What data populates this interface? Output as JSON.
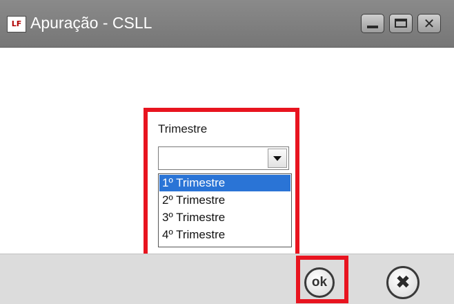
{
  "window": {
    "icon_text": "LF",
    "title": "Apuração - CSLL",
    "controls": {
      "minimize_icon": "minimize-icon",
      "maximize_icon": "maximize-icon",
      "close_icon": "close-icon",
      "close_glyph": "✕"
    }
  },
  "form": {
    "trimestre_label": "Trimestre",
    "trimestre_value": "",
    "options": [
      {
        "label": "1º Trimestre",
        "selected": true
      },
      {
        "label": "2º Trimestre",
        "selected": false
      },
      {
        "label": "3º Trimestre",
        "selected": false
      },
      {
        "label": "4º Trimestre",
        "selected": false
      }
    ]
  },
  "footer": {
    "ok_label": "ok",
    "cancel_glyph": "✖"
  },
  "colors": {
    "highlight": "#e8141f",
    "selection": "#2a74d6",
    "titlebar": "#7f7f7f"
  }
}
